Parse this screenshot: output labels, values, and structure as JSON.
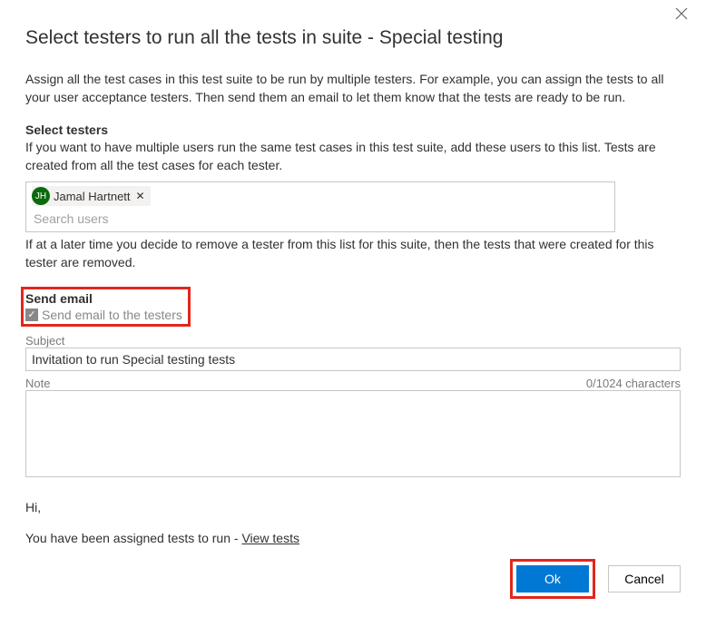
{
  "dialog": {
    "title": "Select testers to run all the tests in suite - Special testing",
    "intro": "Assign all the test cases in this test suite to be run by multiple testers. For example, you can assign the tests to all your user acceptance testers. Then send them an email to let them know that the tests are ready to be run."
  },
  "select_testers": {
    "heading": "Select testers",
    "desc": "If you want to have multiple users run the same test cases in this test suite, add these users to this list. Tests are created from all the test cases for each tester.",
    "chip": {
      "initials": "JH",
      "name": "Jamal Hartnett"
    },
    "search_placeholder": "Search users",
    "after_note": "If at a later time you decide to remove a tester from this list for this suite, then the tests that were created for this tester are removed."
  },
  "send_email": {
    "heading": "Send email",
    "checkbox_label": "Send email to the testers",
    "subject_label": "Subject",
    "subject_value": "Invitation to run Special testing tests",
    "note_label": "Note",
    "note_counter": "0/1024 characters"
  },
  "preview": {
    "greeting": "Hi,",
    "body_prefix": "You have been assigned tests to run - ",
    "link_text": "View tests"
  },
  "buttons": {
    "ok": "Ok",
    "cancel": "Cancel"
  }
}
